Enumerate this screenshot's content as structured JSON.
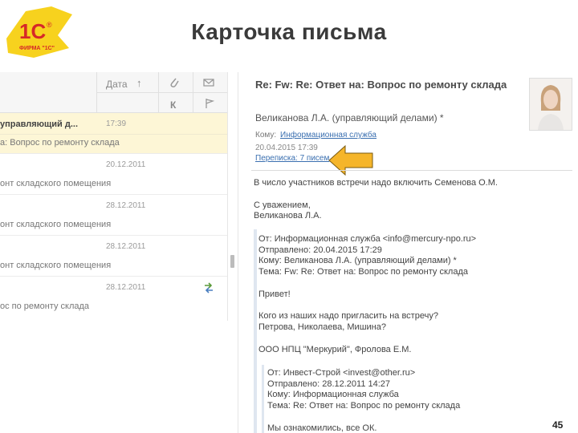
{
  "slide": {
    "title": "Карточка письма",
    "page_number": "45"
  },
  "logo": {
    "text": "1С",
    "caption": "ФИРМА \"1С\""
  },
  "list": {
    "header": {
      "date_label": "Дата",
      "sort_icon": "arrow-up",
      "attach_icon": "paperclip",
      "read_icon": "envelope-arrow",
      "col_k": "К",
      "flag_icon": "flag"
    },
    "rows": [
      {
        "subject": "управляющий д...",
        "date": "17:39",
        "line2": "а: Вопрос по ремонту склада",
        "selected": true
      },
      {
        "subject": "",
        "date": "20.12.2011",
        "line2": "онт складского помещения",
        "selected": false
      },
      {
        "subject": "",
        "date": "28.12.2011",
        "line2": "онт складского помещения",
        "selected": false
      },
      {
        "subject": "",
        "date": "28.12.2011",
        "line2": "онт складского помещения",
        "selected": false
      },
      {
        "subject": "",
        "date": "28.12.2011",
        "line2": "ос по ремонту склада",
        "selected": false,
        "icon": "forward-arrows"
      }
    ]
  },
  "message": {
    "subject": "Re: Fw: Re: Ответ на: Вопрос по ремонту склада",
    "from": "Великанова Л.А. (управляющий делами) *",
    "to_label": "Кому:",
    "to_link": "Информационная служба",
    "sent": "20.04.2015 17:39",
    "thread_link": "Переписка: 7 писем",
    "body": [
      "В число участников встречи надо включить Семенова О.М.",
      "С уважением,",
      "Великанова Л.А."
    ],
    "quote1": [
      "От: Информационная служба <info@mercury-npo.ru>",
      "Отправлено: 20.04.2015 17:29",
      "Кому: Великанова Л.А. (управляющий делами) *",
      "Тема: Fw: Re: Ответ на: Вопрос по ремонту склада",
      "Привет!",
      "Кого из наших надо пригласить на встречу?",
      "Петрова, Николаева, Мишина?",
      "ООО НПЦ \"Меркурий\", Фролова Е.М."
    ],
    "quote2": [
      "От: Инвест-Строй <invest@other.ru>",
      "Отправлено: 28.12.2011 14:27",
      "Кому: Информационная служба",
      "Тема: Re: Ответ на: Вопрос по ремонту склада",
      "Мы ознакомились, все ОК."
    ]
  },
  "colors": {
    "selected_row": "#fdf6d6",
    "link": "#3a6fb0",
    "arrow": "#f5b52a",
    "logo_yellow": "#f7d21e",
    "logo_red": "#d62828"
  }
}
